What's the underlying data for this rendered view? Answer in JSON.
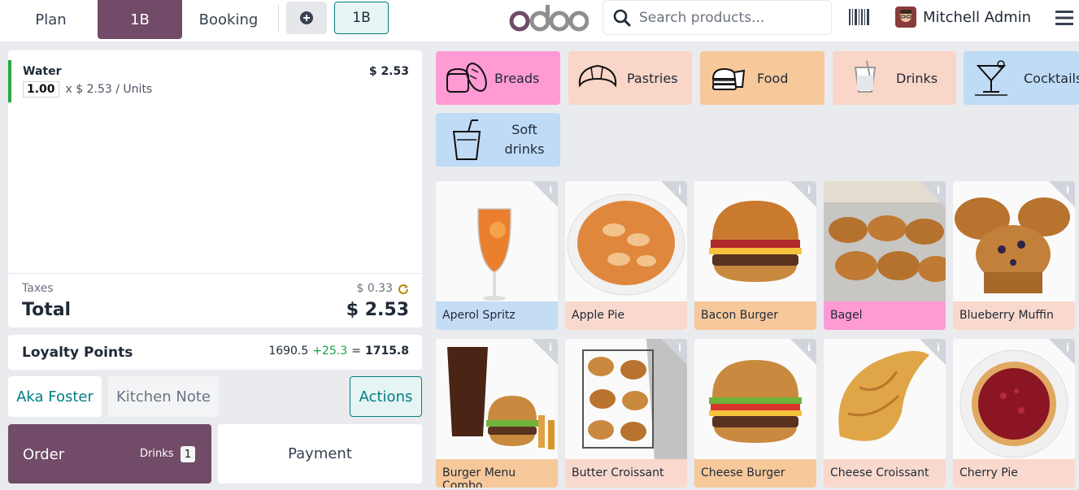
{
  "topbar": {
    "plan_label": "Plan",
    "table_label": "1B",
    "booking_label": "Booking",
    "table_chip": "1B",
    "logo_text": "odoo",
    "search_placeholder": "Search products...",
    "user_name": "Mitchell Admin"
  },
  "order": {
    "line": {
      "name": "Water",
      "qty": "1.00",
      "unit_info": "x $ 2.53 / Units",
      "price": "$ 2.53"
    },
    "taxes_label": "Taxes",
    "taxes_value": "$ 0.33",
    "total_label": "Total",
    "total_value": "$ 2.53"
  },
  "loyalty": {
    "label": "Loyalty Points",
    "current": "1690.5",
    "added": "+25.3",
    "equals": "=",
    "result": "1715.8"
  },
  "controls": {
    "customer": "Aka Foster",
    "kitchen_note": "Kitchen Note",
    "actions": "Actions",
    "order": "Order",
    "order_category": "Drinks",
    "order_count": "1",
    "payment": "Payment"
  },
  "categories": [
    {
      "label": "Breads",
      "color": "#ff9ad5"
    },
    {
      "label": "Pastries",
      "color": "#f9d6c8"
    },
    {
      "label": "Food",
      "color": "#f6c89a"
    },
    {
      "label": "Drinks",
      "color": "#f9d6c8"
    },
    {
      "label": "Cocktails",
      "color": "#bfdbf5"
    },
    {
      "label": "Soft drinks",
      "color": "#bfdbf5"
    }
  ],
  "products": [
    {
      "name": "Aperol Spritz",
      "color": "#c5dcf5"
    },
    {
      "name": "Apple Pie",
      "color": "#f9d9cd"
    },
    {
      "name": "Bacon Burger",
      "color": "#f6c89a"
    },
    {
      "name": "Bagel",
      "color": "#ff9ad5"
    },
    {
      "name": "Blueberry Muffin",
      "color": "#f9d9cd"
    },
    {
      "name": "Burger Menu Combo",
      "color": "#f6c89a"
    },
    {
      "name": "Butter Croissant",
      "color": "#f9d9cd"
    },
    {
      "name": "Cheese Burger",
      "color": "#f6c89a"
    },
    {
      "name": "Cheese Croissant",
      "color": "#f9d9cd"
    },
    {
      "name": "Cherry Pie",
      "color": "#f9d9cd"
    }
  ]
}
